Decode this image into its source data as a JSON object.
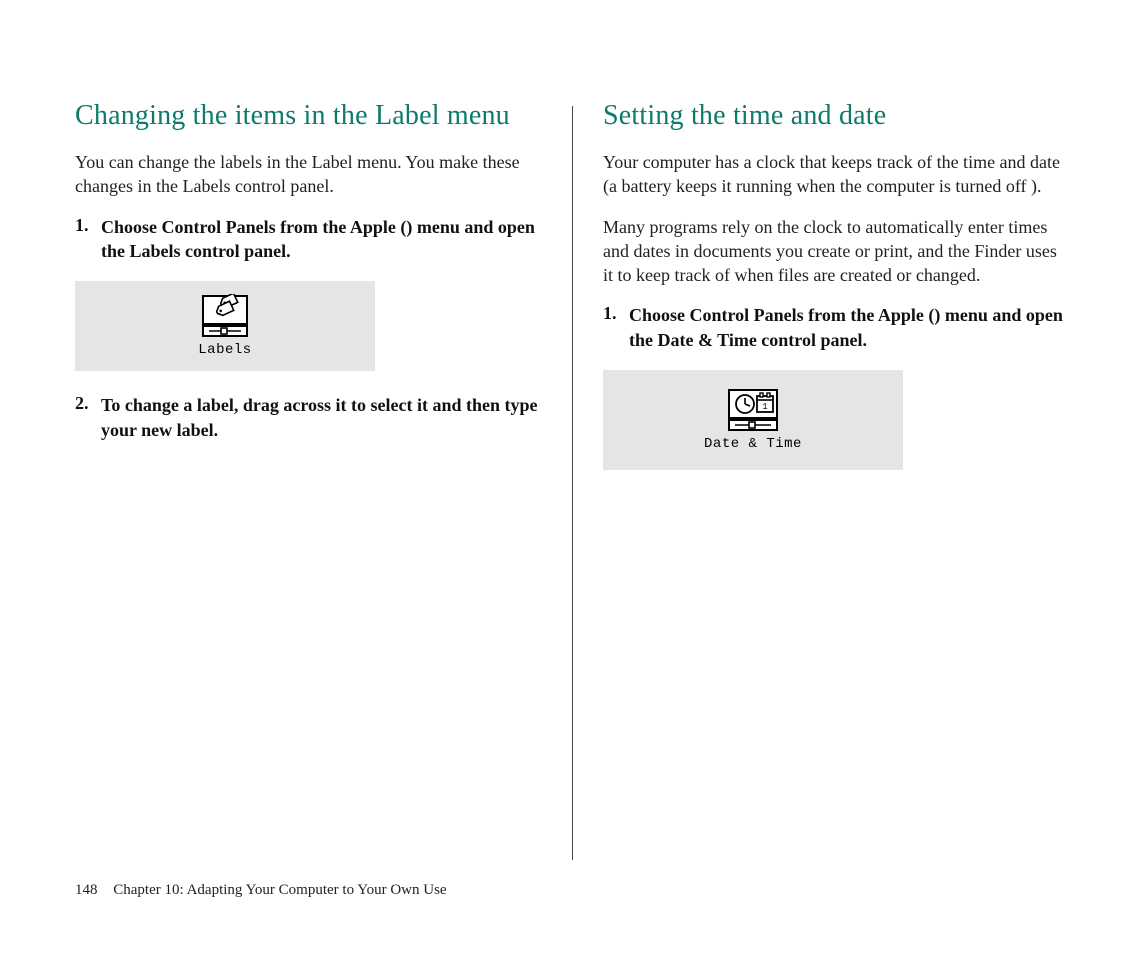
{
  "left": {
    "heading": "Changing the items in the Label menu",
    "intro": "You can change the labels in the Label menu. You make these changes in the Labels control panel.",
    "step1_num": "1.",
    "step1_pre": "Choose Control Panels from the Apple (",
    "step1_post": ") menu and open the Labels control panel.",
    "icon_label": "Labels",
    "step2_num": "2.",
    "step2_text": "To change a label, drag across it to select it and then type your new label."
  },
  "right": {
    "heading": "Setting the time and date",
    "intro1": "Your computer has a clock that keeps track of the time and date (a battery keeps it running when the computer is turned off ).",
    "intro2": "Many programs rely on the clock to automatically enter times and dates in documents you create or print, and the Finder uses it to keep track of when files are created or changed.",
    "step1_num": "1.",
    "step1_pre": "Choose Control Panels from the Apple (",
    "step1_post": ") menu and open the Date & Time control panel.",
    "icon_label": "Date & Time"
  },
  "footer": {
    "page_number": "148",
    "chapter": "Chapter 10:  Adapting Your Computer to Your Own Use"
  }
}
